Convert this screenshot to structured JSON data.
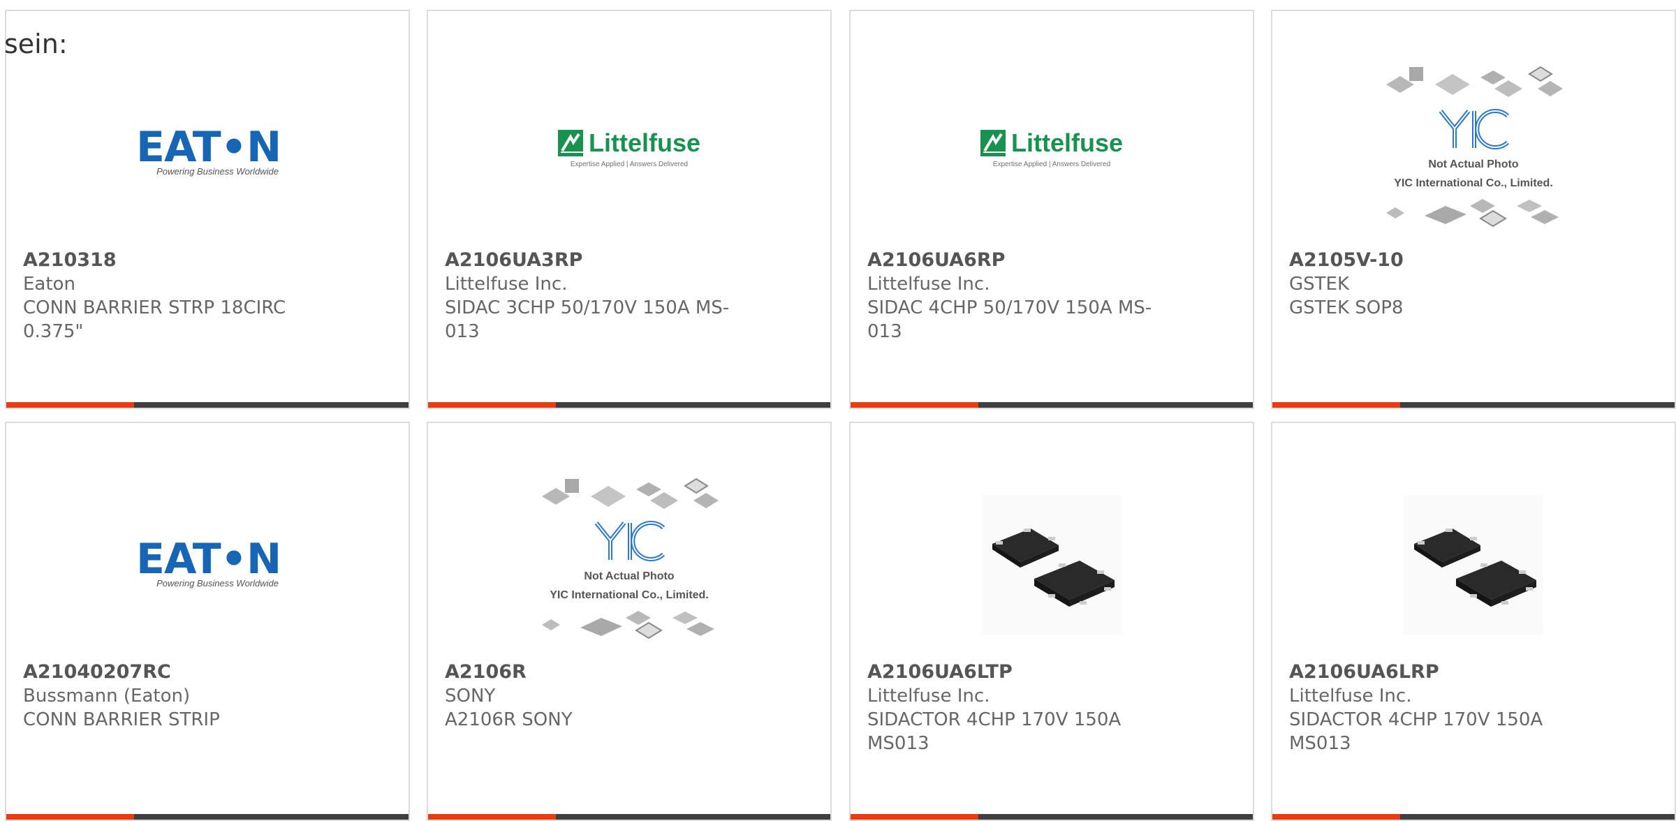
{
  "intro_text": "sein:",
  "colors": {
    "accent_bar": "#e63d12",
    "dark_bar": "#3f3f3f",
    "eaton_blue": "#1765b5",
    "littelfuse_green": "#19924f"
  },
  "products": [
    {
      "part_number": "A210318",
      "manufacturer": "Eaton",
      "description": "CONN BARRIER STRP 18CIRC 0.375\"",
      "image": "eaton-logo",
      "logo": {
        "word": "EAT•N",
        "tagline": "Powering Business Worldwide"
      }
    },
    {
      "part_number": "A2106UA3RP",
      "manufacturer": "Littelfuse Inc.",
      "description": "SIDAC 3CHP 50/170V 150A MS-013",
      "image": "littelfuse-logo",
      "logo": {
        "word": "Littelfuse",
        "tagline": "Expertise Applied | Answers Delivered"
      }
    },
    {
      "part_number": "A2106UA6RP",
      "manufacturer": "Littelfuse Inc.",
      "description": "SIDAC 4CHP 50/170V 150A MS-013",
      "image": "littelfuse-logo",
      "logo": {
        "word": "Littelfuse",
        "tagline": "Expertise Applied | Answers Delivered"
      }
    },
    {
      "part_number": "A2105V-10",
      "manufacturer": "GSTEK",
      "description": "GSTEK SOP8",
      "image": "yic-placeholder",
      "logo": {
        "caption_1": "Not Actual Photo",
        "caption_2": "YIC International Co., Limited."
      }
    },
    {
      "part_number": "A21040207RC",
      "manufacturer": "Bussmann (Eaton)",
      "description": "CONN BARRIER STRIP",
      "image": "eaton-logo",
      "logo": {
        "word": "EAT•N",
        "tagline": "Powering Business Worldwide"
      }
    },
    {
      "part_number": "A2106R",
      "manufacturer": "SONY",
      "description": "A2106R SONY",
      "image": "yic-placeholder",
      "logo": {
        "caption_1": "Not Actual Photo",
        "caption_2": "YIC International Co., Limited."
      }
    },
    {
      "part_number": "A2106UA6LTP",
      "manufacturer": "Littelfuse Inc.",
      "description": "SIDACTOR 4CHP 170V 150A MS013",
      "image": "chip-photo"
    },
    {
      "part_number": "A2106UA6LRP",
      "manufacturer": "Littelfuse Inc.",
      "description": "SIDACTOR 4CHP 170V 150A MS013",
      "image": "chip-photo"
    }
  ]
}
